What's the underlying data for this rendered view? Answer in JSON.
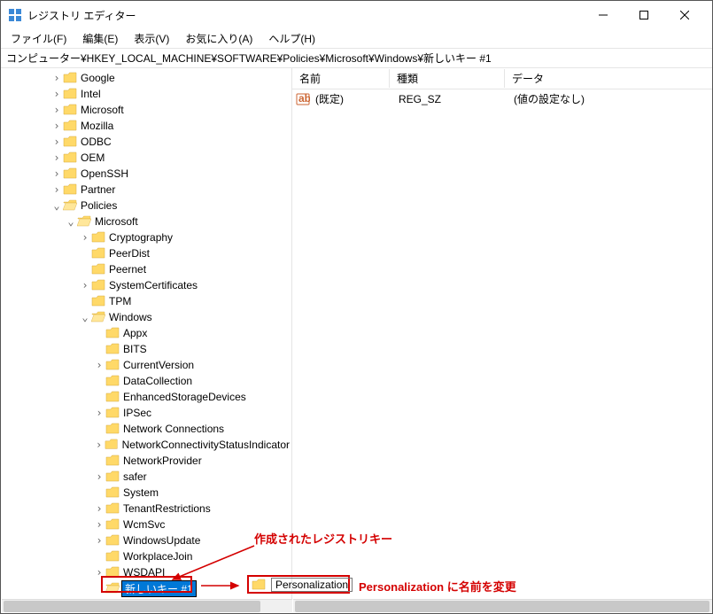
{
  "window": {
    "title": "レジストリ エディター"
  },
  "menu": {
    "file": "ファイル(F)",
    "edit": "編集(E)",
    "view": "表示(V)",
    "favorites": "お気に入り(A)",
    "help": "ヘルプ(H)"
  },
  "address": "コンピューター¥HKEY_LOCAL_MACHINE¥SOFTWARE¥Policies¥Microsoft¥Windows¥新しいキー #1",
  "columns": {
    "name": "名前",
    "type": "種類",
    "data": "データ"
  },
  "default_value": {
    "name": "(既定)",
    "type": "REG_SZ",
    "data": "(値の設定なし)"
  },
  "tree": {
    "software_children": [
      {
        "label": "Google",
        "children": true
      },
      {
        "label": "Intel",
        "children": true
      },
      {
        "label": "Microsoft",
        "children": true
      },
      {
        "label": "Mozilla",
        "children": true
      },
      {
        "label": "ODBC",
        "children": true
      },
      {
        "label": "OEM",
        "children": true
      },
      {
        "label": "OpenSSH",
        "children": true
      },
      {
        "label": "Partner",
        "children": true
      }
    ],
    "policies_label": "Policies",
    "microsoft_label": "Microsoft",
    "microsoft_children": [
      {
        "label": "Cryptography",
        "children": true
      },
      {
        "label": "PeerDist",
        "children": false
      },
      {
        "label": "Peernet",
        "children": false
      },
      {
        "label": "SystemCertificates",
        "children": true
      },
      {
        "label": "TPM",
        "children": false
      }
    ],
    "windows_label": "Windows",
    "windows_children": [
      {
        "label": "Appx",
        "children": false
      },
      {
        "label": "BITS",
        "children": false
      },
      {
        "label": "CurrentVersion",
        "children": true
      },
      {
        "label": "DataCollection",
        "children": false
      },
      {
        "label": "EnhancedStorageDevices",
        "children": false
      },
      {
        "label": "IPSec",
        "children": true
      },
      {
        "label": "Network Connections",
        "children": false
      },
      {
        "label": "NetworkConnectivityStatusIndicator",
        "children": true
      },
      {
        "label": "NetworkProvider",
        "children": false
      },
      {
        "label": "safer",
        "children": true
      },
      {
        "label": "System",
        "children": false
      },
      {
        "label": "TenantRestrictions",
        "children": true
      },
      {
        "label": "WcmSvc",
        "children": true
      },
      {
        "label": "WindowsUpdate",
        "children": true
      },
      {
        "label": "WorkplaceJoin",
        "children": false
      },
      {
        "label": "WSDAPI",
        "children": true
      }
    ],
    "new_key_label": "新しいキー #1"
  },
  "annotations": {
    "created_key": "作成されたレジストリキー",
    "rename_target": "Personalization",
    "rename_instruction": "Personalization に名前を変更"
  }
}
